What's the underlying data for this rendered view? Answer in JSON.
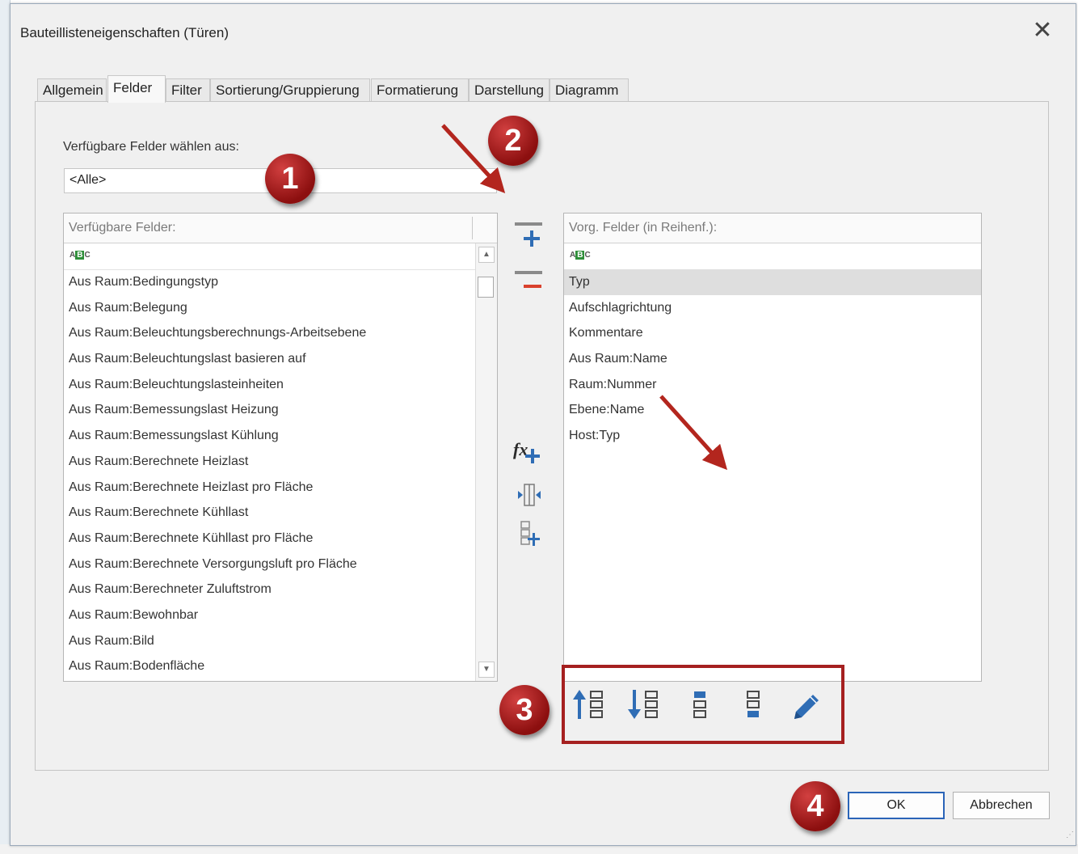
{
  "dialog": {
    "title": "Bauteillisteneigenschaften (Türen)",
    "close": "✕"
  },
  "tabs": [
    "Allgemein",
    "Felder",
    "Filter",
    "Sortierung/Gruppierung",
    "Formatierung",
    "Darstellung",
    "Diagramm"
  ],
  "active_tab": "Felder",
  "fields": {
    "source_label": "Verfügbare Felder wählen aus:",
    "source_value": "<Alle>",
    "available_header": "Verfügbare Felder:",
    "scheduled_header": "Vorg. Felder (in Reihenf.):",
    "filter_icon": "abc-filter-icon",
    "available": [
      "Aus Raum:Bedingungstyp",
      "Aus Raum:Belegung",
      "Aus Raum:Beleuchtungsberechnungs-Arbeitsebene",
      "Aus Raum:Beleuchtungslast basieren auf",
      "Aus Raum:Beleuchtungslasteinheiten",
      "Aus Raum:Bemessungslast Heizung",
      "Aus Raum:Bemessungslast Kühlung",
      "Aus Raum:Berechnete Heizlast",
      "Aus Raum:Berechnete Heizlast pro Fläche",
      "Aus Raum:Berechnete Kühllast",
      "Aus Raum:Berechnete Kühllast pro Fläche",
      "Aus Raum:Berechnete Versorgungsluft pro Fläche",
      "Aus Raum:Berechneter Zuluftstrom",
      "Aus Raum:Bewohnbar",
      "Aus Raum:Bild",
      "Aus Raum:Bodenfläche"
    ],
    "scheduled": [
      "Typ",
      "Aufschlagrichtung",
      "Kommentare",
      "Aus Raum:Name",
      "Raum:Nummer",
      "Ebene:Name",
      "Host:Typ"
    ],
    "selected_scheduled": "Typ"
  },
  "middle_buttons": [
    "add-parameter-icon",
    "remove-parameter-icon",
    "calculated-value-icon",
    "combine-parameters-icon",
    "new-parameter-icon"
  ],
  "bottom_buttons": [
    "move-up-icon",
    "move-down-icon",
    "move-to-top-icon",
    "move-to-bottom-icon",
    "edit-parameter-icon"
  ],
  "buttons": {
    "ok": "OK",
    "cancel": "Abbrechen"
  },
  "callouts": [
    "1",
    "2",
    "3",
    "4"
  ],
  "colors": {
    "callout": "#a52020",
    "ok_border": "#2a64b8",
    "icon_blue": "#2f6db5",
    "icon_red": "#d9412d"
  }
}
